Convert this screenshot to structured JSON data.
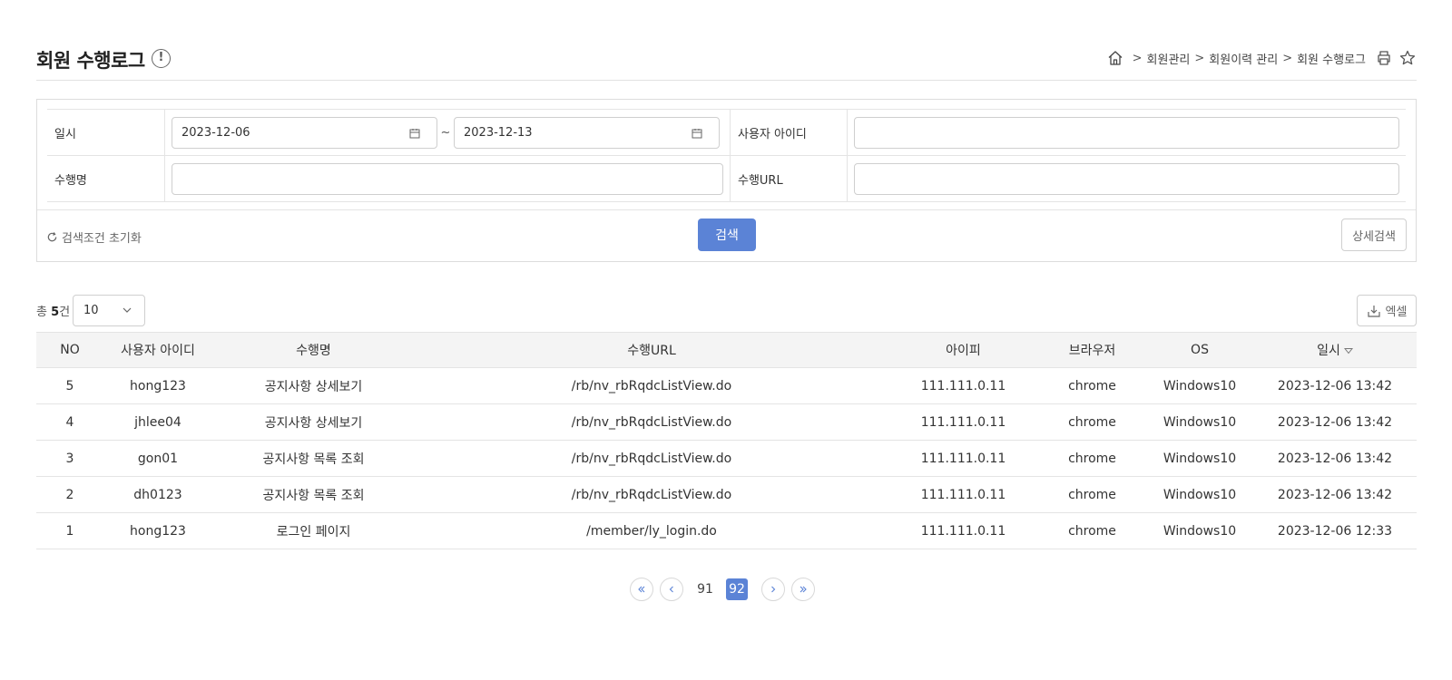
{
  "header": {
    "title": "회원 수행로그",
    "info_icon": "info-circle-icon",
    "breadcrumb": [
      "회원관리",
      "회원이력 관리",
      "회원 수행로그"
    ],
    "breadcrumb_sep": ">"
  },
  "search": {
    "date_label": "일시",
    "date_from": "2023-12-06",
    "date_to": "2023-12-13",
    "tilde": "~",
    "user_id_label": "사용자 아이디",
    "user_id_value": "",
    "action_name_label": "수행명",
    "action_name_value": "",
    "action_url_label": "수행URL",
    "action_url_value": "",
    "reset_label": "검색조건 초기화",
    "search_button": "검색",
    "detail_button": "상세검색"
  },
  "list": {
    "total_prefix": "총",
    "total_count": "5",
    "total_suffix": "건",
    "page_size": "10",
    "excel_button": "엑셀",
    "columns": [
      "NO",
      "사용자 아이디",
      "수행명",
      "수행URL",
      "아이피",
      "브라우저",
      "OS",
      "일시"
    ],
    "rows": [
      [
        "5",
        "hong123",
        "공지사항 상세보기",
        "/rb/nv_rbRqdcListView.do",
        "111.111.0.11",
        "chrome",
        "Windows10",
        "2023-12-06 13:42"
      ],
      [
        "4",
        "jhlee04",
        "공지사항 상세보기",
        "/rb/nv_rbRqdcListView.do",
        "111.111.0.11",
        "chrome",
        "Windows10",
        "2023-12-06 13:42"
      ],
      [
        "3",
        "gon01",
        "공지사항 목록 조회",
        "/rb/nv_rbRqdcListView.do",
        "111.111.0.11",
        "chrome",
        "Windows10",
        "2023-12-06 13:42"
      ],
      [
        "2",
        "dh0123",
        "공지사항 목록 조회",
        "/rb/nv_rbRqdcListView.do",
        "111.111.0.11",
        "chrome",
        "Windows10",
        "2023-12-06 13:42"
      ],
      [
        "1",
        "hong123",
        "로그인 페이지",
        "/member/ly_login.do",
        "111.111.0.11",
        "chrome",
        "Windows10",
        "2023-12-06 12:33"
      ]
    ]
  },
  "pagination": {
    "pages": [
      "91",
      "92"
    ],
    "current": "92"
  },
  "colors": {
    "accent": "#5b83d6",
    "border": "#e4e4e4",
    "header_bg": "#f4f4f4"
  }
}
